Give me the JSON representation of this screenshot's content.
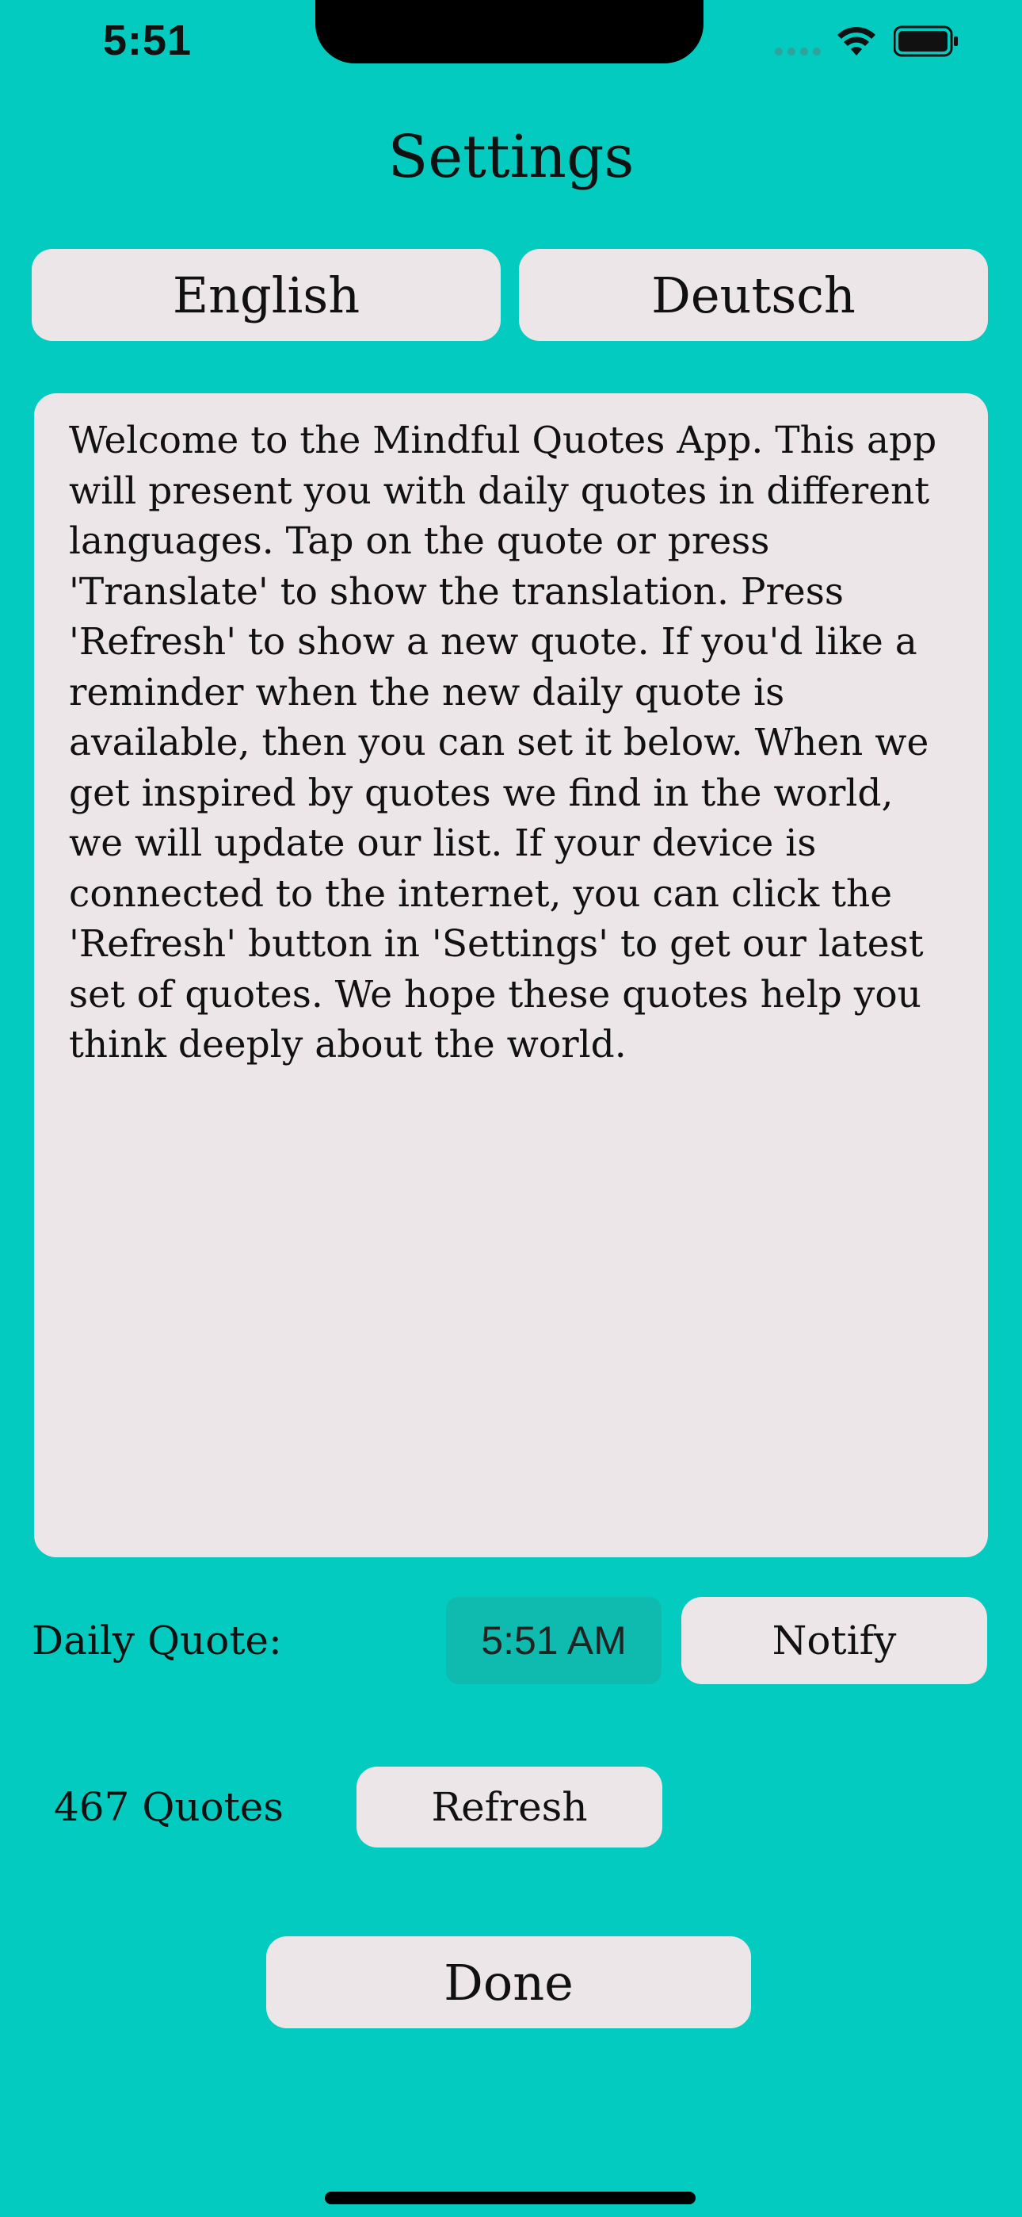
{
  "status_bar": {
    "time": "5:51"
  },
  "header": {
    "title": "Settings"
  },
  "languages": {
    "english": "English",
    "deutsch": "Deutsch"
  },
  "info": {
    "text": "Welcome to the Mindful Quotes App. This app will present you with daily quotes in different languages. Tap on the quote or press 'Translate' to show the translation. Press 'Refresh' to show a new quote. If you'd like a reminder when the new daily quote is available, then you can set it below. When we get inspired by quotes we find in the world, we will update our list. If your device is connected to the internet, you can click the 'Refresh' button in 'Settings' to get our latest set of quotes. We hope these quotes help you think deeply about the world."
  },
  "daily": {
    "label": "Daily Quote:",
    "time": "5:51 AM",
    "notify_label": "Notify"
  },
  "quotes": {
    "count_label": "467 Quotes",
    "refresh_label": "Refresh"
  },
  "footer": {
    "done_label": "Done"
  },
  "colors": {
    "background": "#03cbbf",
    "button": "#ede6e8",
    "time_chip": "#0fbbae"
  }
}
